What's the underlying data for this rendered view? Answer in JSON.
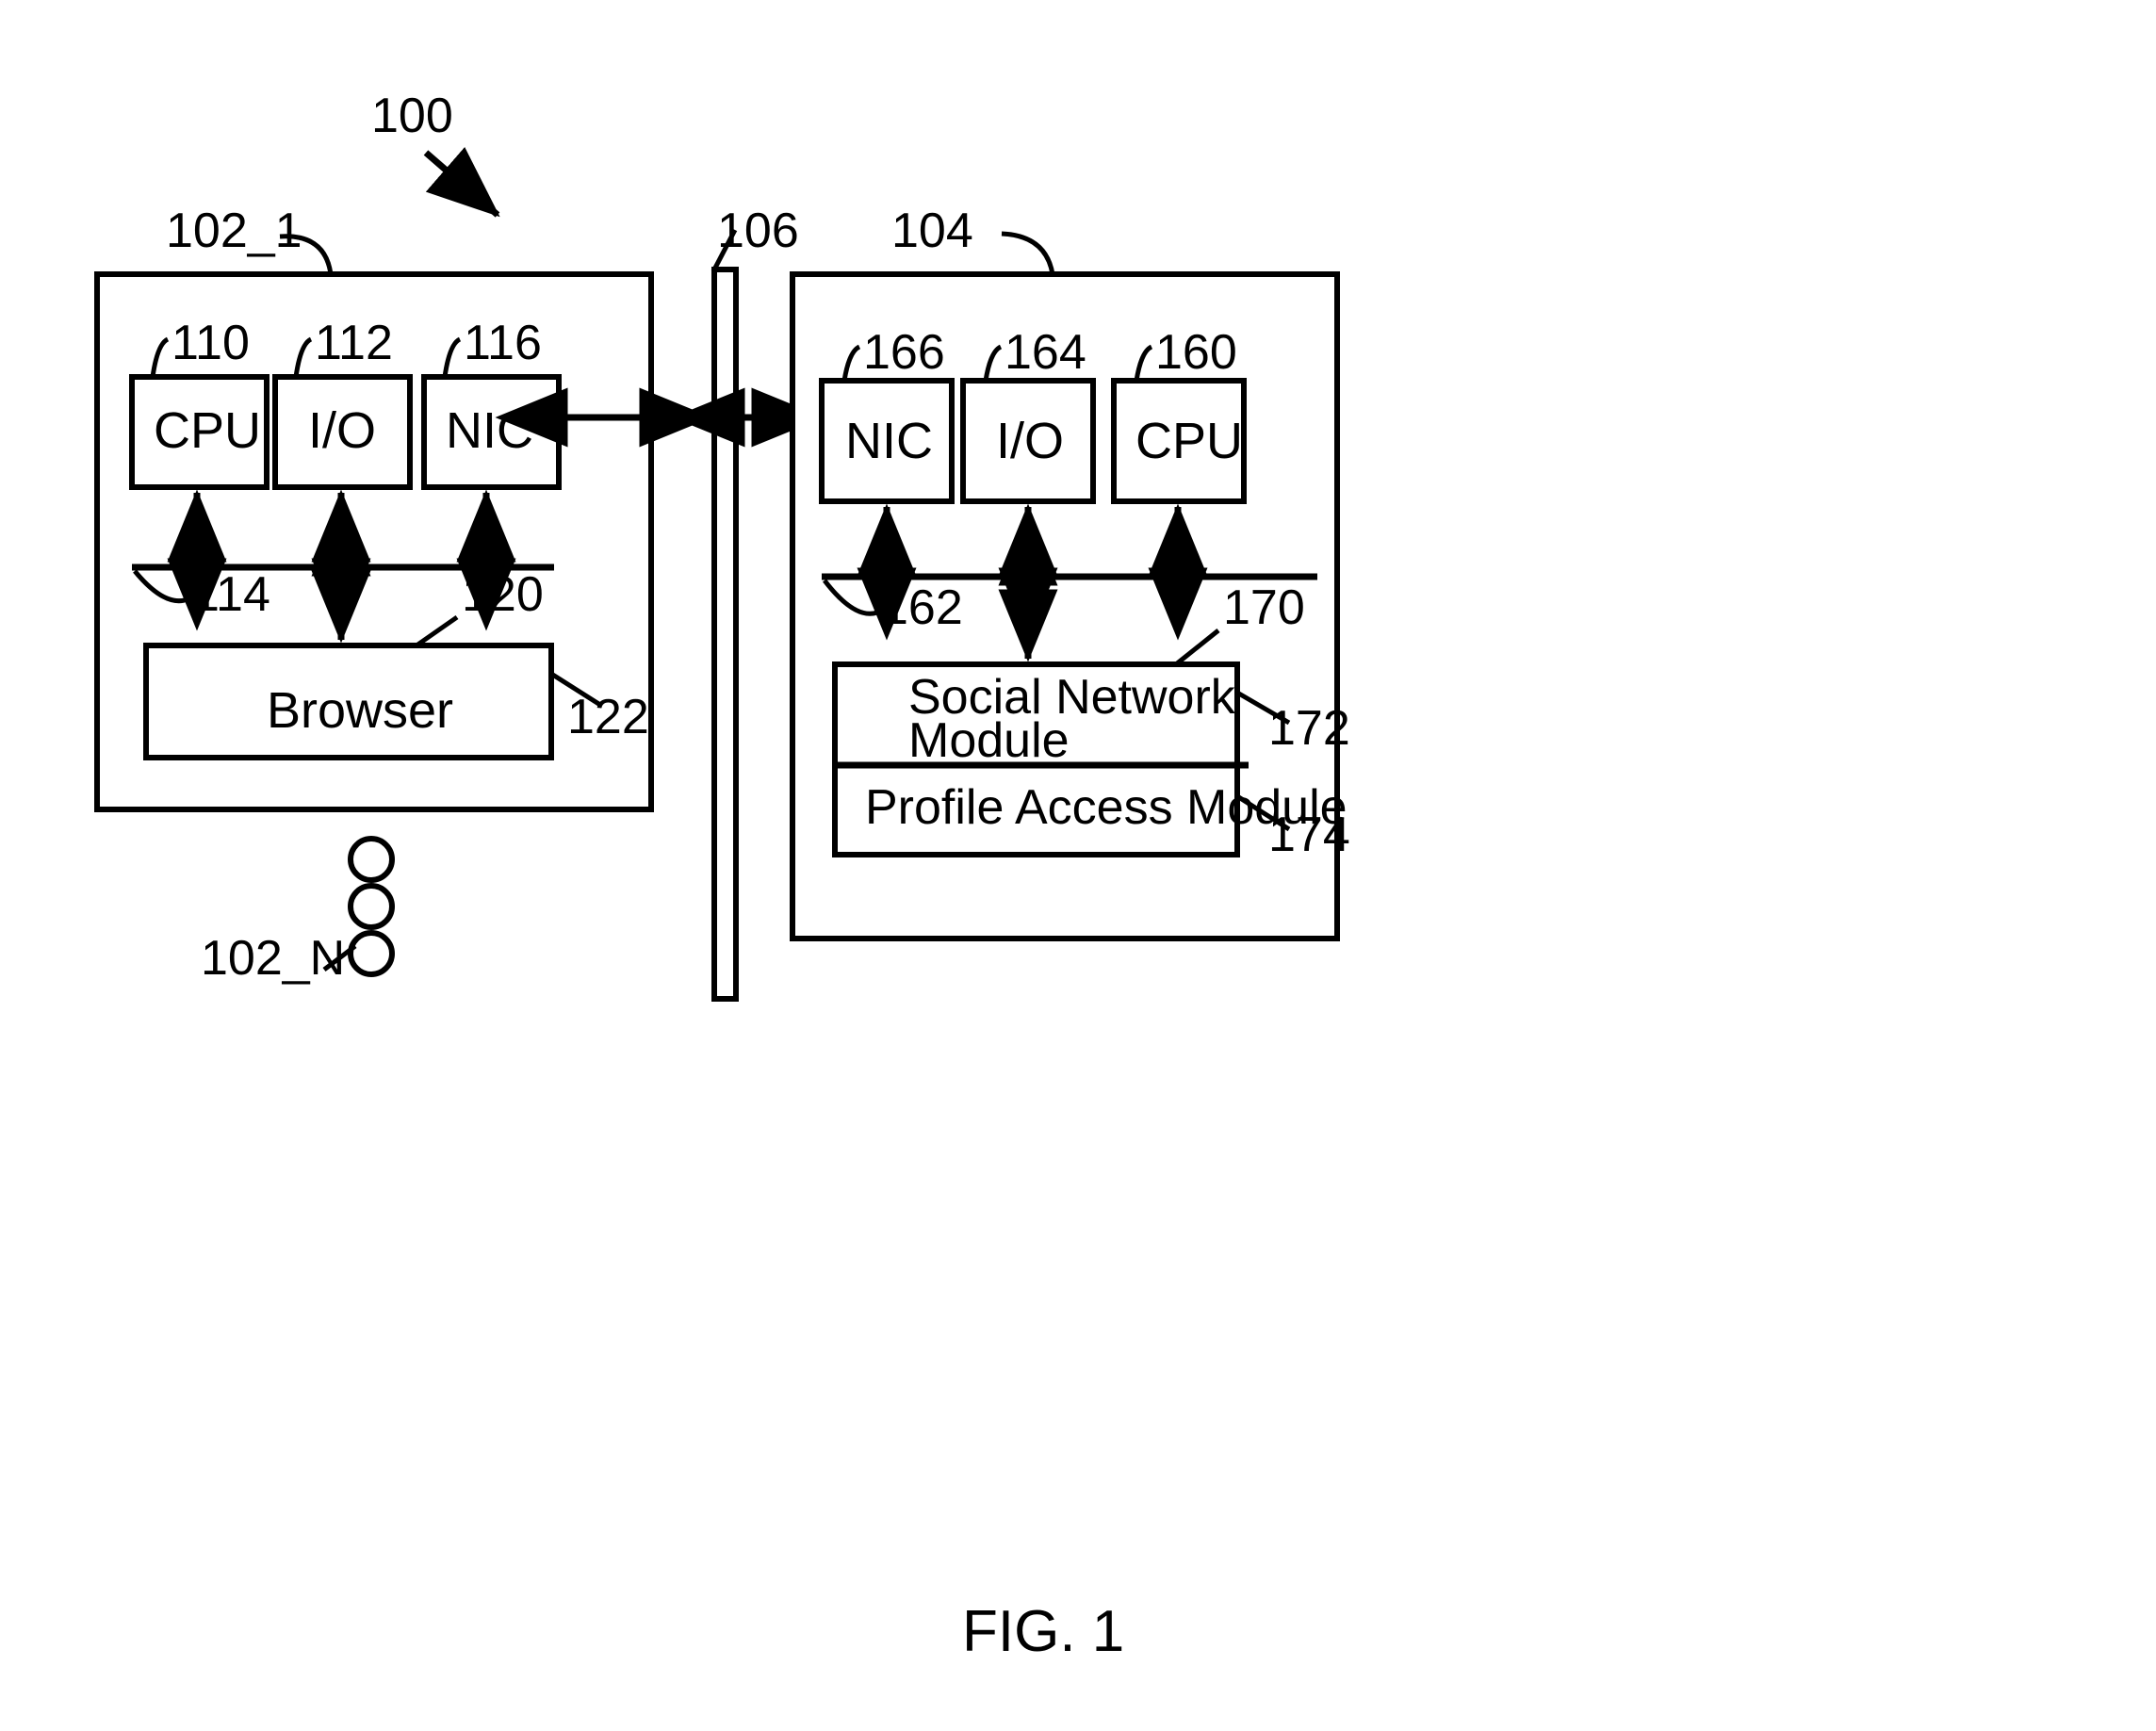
{
  "figure": {
    "caption": "FIG. 1",
    "system_ref": "100"
  },
  "client": {
    "ref": "102_1",
    "ref_last": "102_N",
    "components": [
      {
        "label": "CPU",
        "ref": "110"
      },
      {
        "label": "I/O",
        "ref": "112"
      },
      {
        "label": "NIC",
        "ref": "116"
      }
    ],
    "bus_ref": "114",
    "browser": {
      "label": "Browser",
      "ref_top": "120",
      "ref_side": "122"
    }
  },
  "network": {
    "ref": "106"
  },
  "server": {
    "ref": "104",
    "components": [
      {
        "label": "NIC",
        "ref": "166"
      },
      {
        "label": "I/O",
        "ref": "164"
      },
      {
        "label": "CPU",
        "ref": "160"
      }
    ],
    "bus_ref": "162",
    "modules": {
      "container_ref": "170",
      "social_network": {
        "line1": "Social Network",
        "line2": "Module",
        "ref": "172"
      },
      "profile_access": {
        "label": "Profile Access Module",
        "ref": "174"
      }
    }
  },
  "colors": {
    "line": "#000000",
    "background": "#ffffff"
  }
}
